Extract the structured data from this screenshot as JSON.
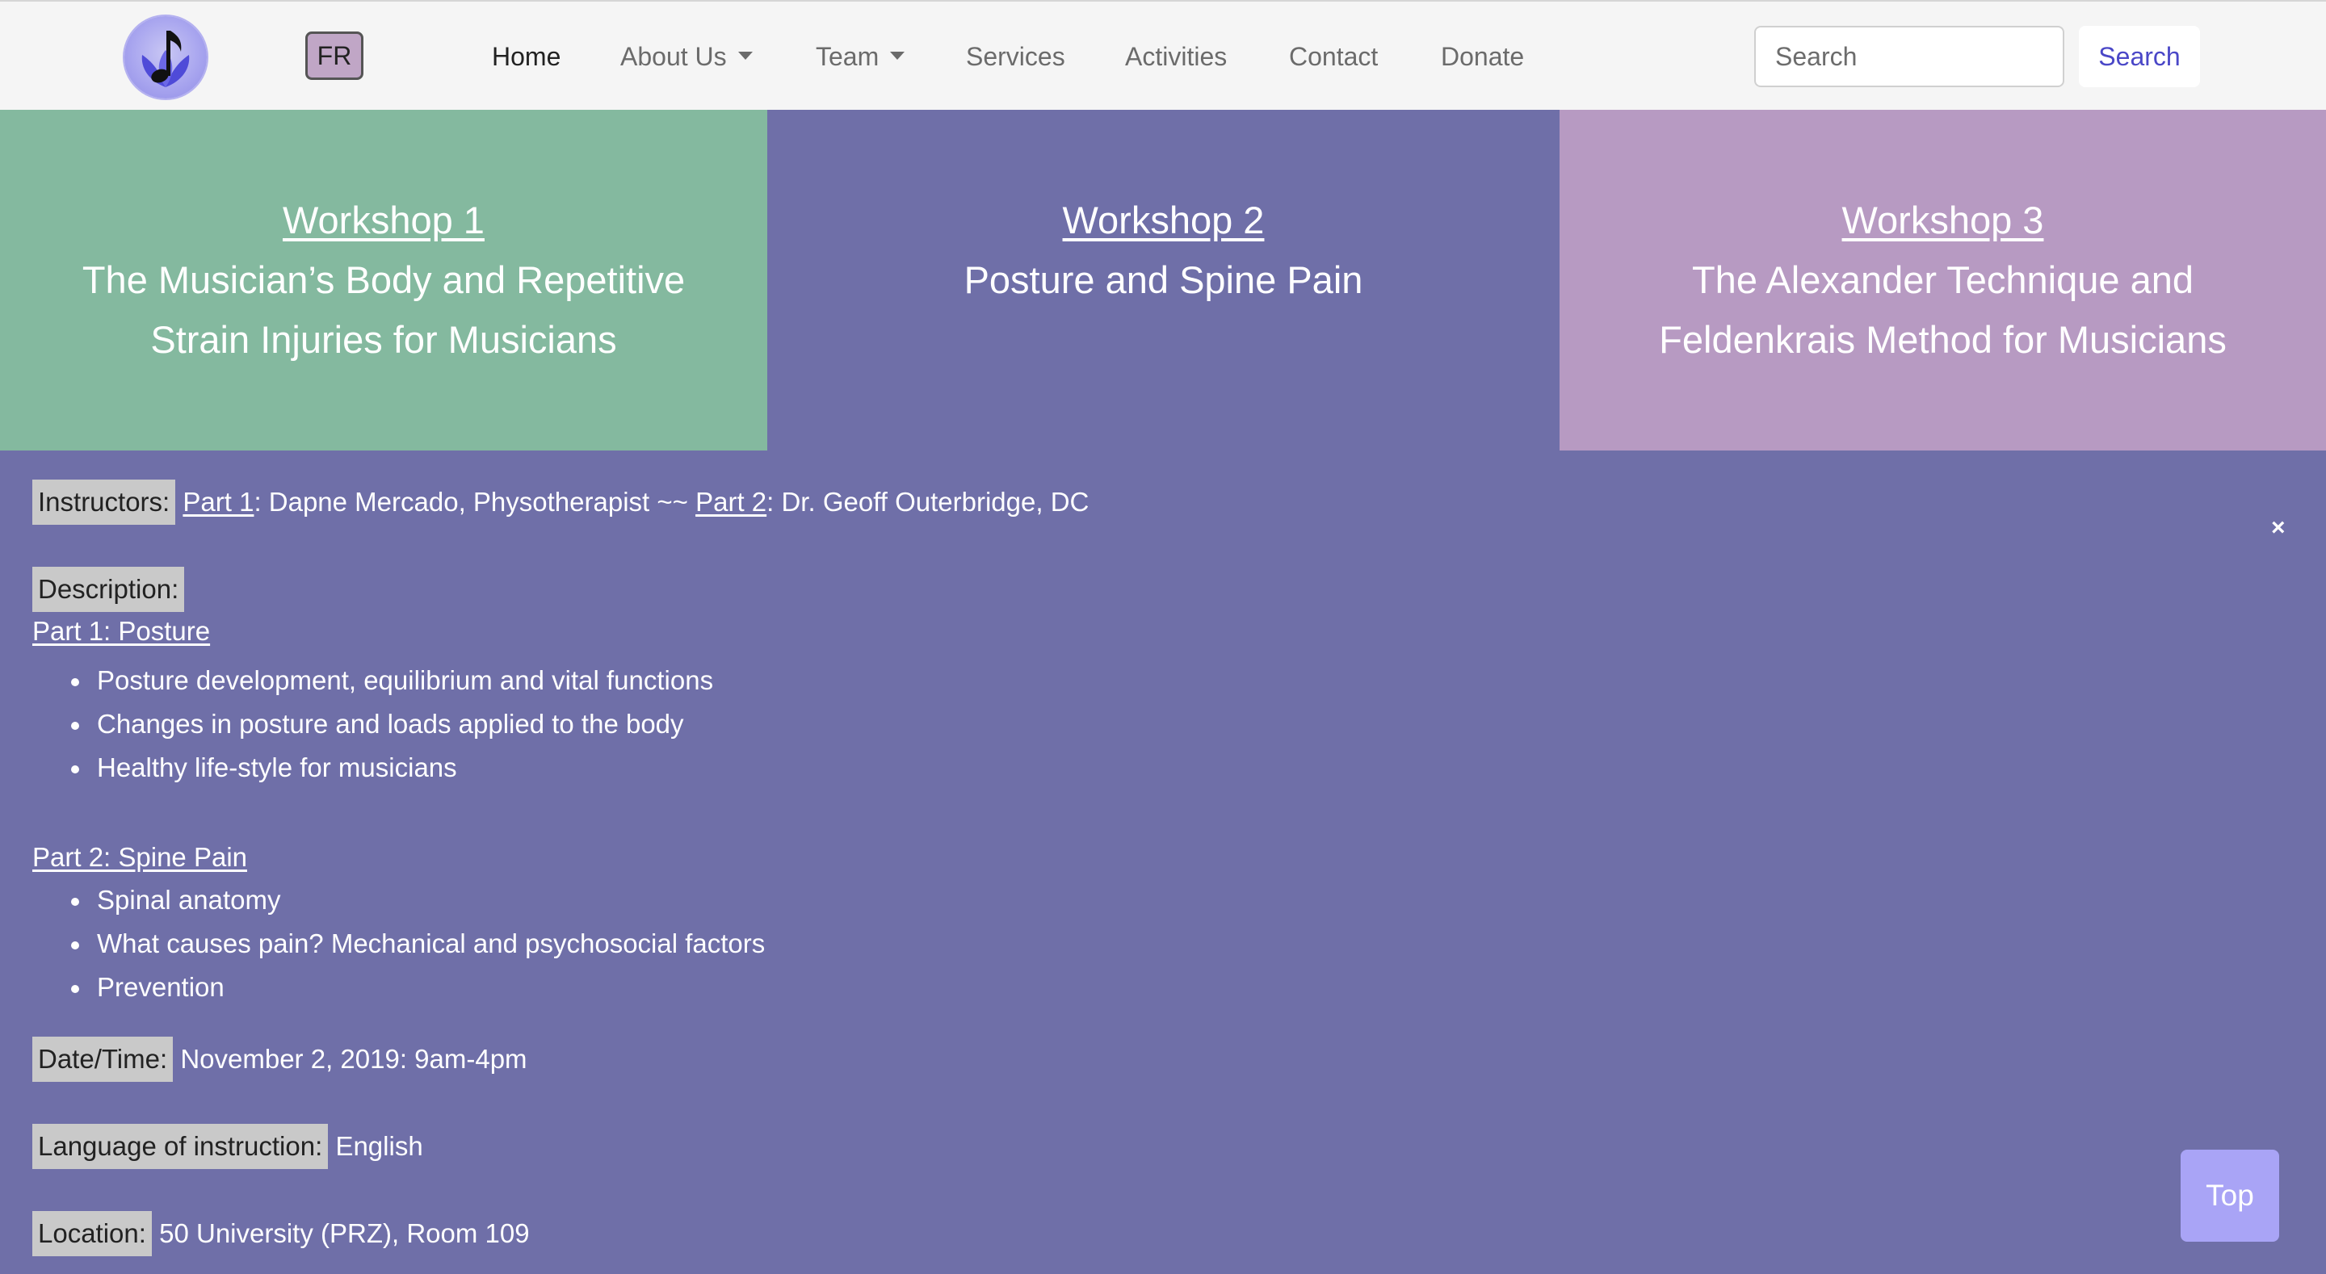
{
  "navbar": {
    "logo_icon": "music-note-lotus-icon",
    "lang_button": "FR",
    "items": [
      {
        "label": "Home",
        "active": true
      },
      {
        "label": "About Us",
        "dropdown": true
      },
      {
        "label": "Team",
        "dropdown": true
      },
      {
        "label": "Services"
      },
      {
        "label": "Activities"
      },
      {
        "label": "Contact"
      },
      {
        "label": "Donate"
      }
    ],
    "search": {
      "placeholder": "Search",
      "button": "Search"
    }
  },
  "workshops": [
    {
      "heading": "Workshop 1",
      "title_line1": "The Musician’s Body and Repetitive",
      "title_line2": "Strain Injuries for Musicians",
      "color": "#84b99f"
    },
    {
      "heading": "Workshop 2",
      "title_line1": "Posture and Spine Pain",
      "title_line2": "",
      "color": "#6f6fa8"
    },
    {
      "heading": "Workshop 3",
      "title_line1": "The Alexander Technique and",
      "title_line2": "Feldenkrais Method for Musicians",
      "color": "#b79ac2"
    }
  ],
  "details": {
    "instructors": {
      "label": "Instructors:",
      "part1_label": "Part 1",
      "part1_text": ": Dapne Mercado, Physotherapist ~~ ",
      "part2_label": "Part 2",
      "part2_text": ": Dr. Geoff Outerbridge, DC"
    },
    "description": {
      "label": "Description:",
      "part1_heading": "Part 1: Posture",
      "part1_items": [
        "Posture development, equilibrium and vital functions",
        "Changes in posture and loads applied to the body",
        "Healthy life-style for musicians"
      ],
      "part2_heading": "Part 2: Spine Pain",
      "part2_items": [
        "Spinal anatomy",
        "What causes pain? Mechanical and psychosocial factors",
        "Prevention"
      ]
    },
    "datetime": {
      "label": "Date/Time:",
      "value": "November 2, 2019: 9am-4pm"
    },
    "language": {
      "label": "Language of instruction:",
      "value": "English"
    },
    "location": {
      "label": "Location:",
      "value": "50 University (PRZ), Room 109"
    }
  },
  "close_symbol": "×",
  "top_button": "Top"
}
